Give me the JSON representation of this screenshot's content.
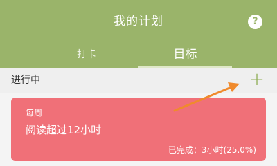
{
  "header": {
    "title": "我的计划",
    "help_icon": "?",
    "tabs": [
      {
        "label": "打卡",
        "active": false
      },
      {
        "label": "目标",
        "active": true
      }
    ]
  },
  "section": {
    "label": "进行中",
    "add_label": "+"
  },
  "card": {
    "period": "每周",
    "title": "阅读超过12小时",
    "progress": "已完成：3小时(25.0%)"
  },
  "colors": {
    "header": "#9ab46a",
    "card": "#f07078",
    "arrow": "#f08a2c"
  }
}
